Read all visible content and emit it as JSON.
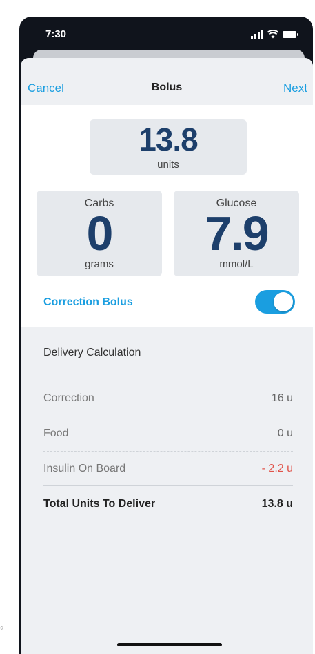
{
  "status": {
    "time": "7:30"
  },
  "nav": {
    "cancel_label": "Cancel",
    "title": "Bolus",
    "next_label": "Next"
  },
  "bolus": {
    "value": "13.8",
    "unit": "units"
  },
  "carbs": {
    "title": "Carbs",
    "value": "0",
    "unit": "grams"
  },
  "glucose": {
    "title": "Glucose",
    "value": "7.9",
    "unit": "mmol/L"
  },
  "correction": {
    "label": "Correction Bolus",
    "enabled": true
  },
  "calculation": {
    "title": "Delivery Calculation",
    "rows": [
      {
        "label": "Correction",
        "value": "16 u"
      },
      {
        "label": "Food",
        "value": "0 u"
      },
      {
        "label": "Insulin On Board",
        "value": "- 2.2 u"
      }
    ],
    "total": {
      "label": "Total Units To Deliver",
      "value": "13.8 u"
    }
  },
  "colors": {
    "accent": "#1a9ee0",
    "number": "#1d3f6b",
    "negative": "#e0534a"
  },
  "icons": [
    "signal-icon",
    "wifi-icon",
    "battery-icon"
  ]
}
